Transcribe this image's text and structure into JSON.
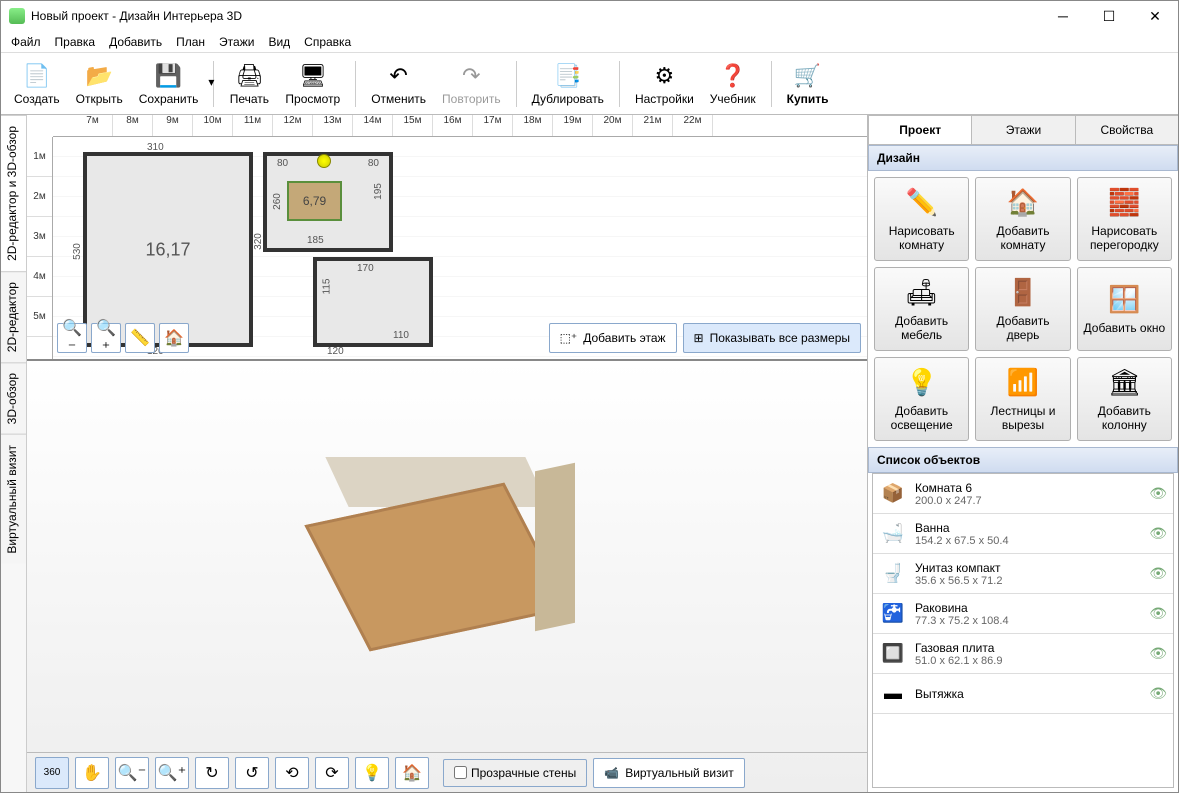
{
  "window": {
    "title": "Новый проект - Дизайн Интерьера 3D"
  },
  "menu": [
    "Файл",
    "Правка",
    "Добавить",
    "План",
    "Этажи",
    "Вид",
    "Справка"
  ],
  "toolbar": [
    {
      "id": "new",
      "label": "Создать",
      "icon": "📄"
    },
    {
      "id": "open",
      "label": "Открыть",
      "icon": "📂"
    },
    {
      "id": "save",
      "label": "Сохранить",
      "icon": "💾",
      "dropdown": true
    },
    {
      "sep": true
    },
    {
      "id": "print",
      "label": "Печать",
      "icon": "🖨"
    },
    {
      "id": "preview",
      "label": "Просмотр",
      "icon": "🖥"
    },
    {
      "sep": true
    },
    {
      "id": "undo",
      "label": "Отменить",
      "icon": "↶"
    },
    {
      "id": "redo",
      "label": "Повторить",
      "icon": "↷",
      "disabled": true
    },
    {
      "sep": true
    },
    {
      "id": "duplicate",
      "label": "Дублировать",
      "icon": "📑"
    },
    {
      "sep": true
    },
    {
      "id": "settings",
      "label": "Настройки",
      "icon": "⚙"
    },
    {
      "id": "help",
      "label": "Учебник",
      "icon": "❓"
    },
    {
      "sep": true
    },
    {
      "id": "buy",
      "label": "Купить",
      "icon": "🛒",
      "bold": true
    }
  ],
  "vtabs": [
    "2D-редактор и 3D-обзор",
    "2D-редактор",
    "3D-обзор",
    "Виртуальный визит"
  ],
  "ruler_h": [
    "7м",
    "8м",
    "9м",
    "10м",
    "11м",
    "12м",
    "13м",
    "14м",
    "15м",
    "16м",
    "17м",
    "18м",
    "19м",
    "20м",
    "21м",
    "22м"
  ],
  "ruler_v": [
    "1м",
    "2м",
    "3м",
    "4м",
    "5м"
  ],
  "rooms": {
    "r1_area": "16,17",
    "r2_area": "6,79",
    "dims": [
      "310",
      "80",
      "80",
      "260",
      "185",
      "195",
      "320",
      "530",
      "120",
      "115",
      "170",
      "110",
      "120"
    ]
  },
  "plan_buttons": {
    "add_floor": "Добавить этаж",
    "show_dims": "Показывать все размеры"
  },
  "bottom": {
    "transparent": "Прозрачные стены",
    "virtual": "Виртуальный визит"
  },
  "rtabs": [
    "Проект",
    "Этажи",
    "Свойства"
  ],
  "sections": {
    "design": "Дизайн",
    "objects": "Список объектов"
  },
  "design_buttons": [
    {
      "label": "Нарисовать комнату",
      "icon": "✏️"
    },
    {
      "label": "Добавить комнату",
      "icon": "🏠"
    },
    {
      "label": "Нарисовать перегородку",
      "icon": "🧱"
    },
    {
      "label": "Добавить мебель",
      "icon": "🛋"
    },
    {
      "label": "Добавить дверь",
      "icon": "🚪"
    },
    {
      "label": "Добавить окно",
      "icon": "🪟"
    },
    {
      "label": "Добавить освещение",
      "icon": "💡"
    },
    {
      "label": "Лестницы и вырезы",
      "icon": "📶"
    },
    {
      "label": "Добавить колонну",
      "icon": "🏛"
    }
  ],
  "objects": [
    {
      "name": "Комната 6",
      "dims": "200.0 x 247.7",
      "icon": "📦"
    },
    {
      "name": "Ванна",
      "dims": "154.2 x 67.5 x 50.4",
      "icon": "🛁"
    },
    {
      "name": "Унитаз компакт",
      "dims": "35.6 x 56.5 x 71.2",
      "icon": "🚽"
    },
    {
      "name": "Раковина",
      "dims": "77.3 x 75.2 x 108.4",
      "icon": "🚰"
    },
    {
      "name": "Газовая плита",
      "dims": "51.0 x 62.1 x 86.9",
      "icon": "🔲"
    },
    {
      "name": "Вытяжка",
      "dims": "",
      "icon": "▬"
    }
  ]
}
